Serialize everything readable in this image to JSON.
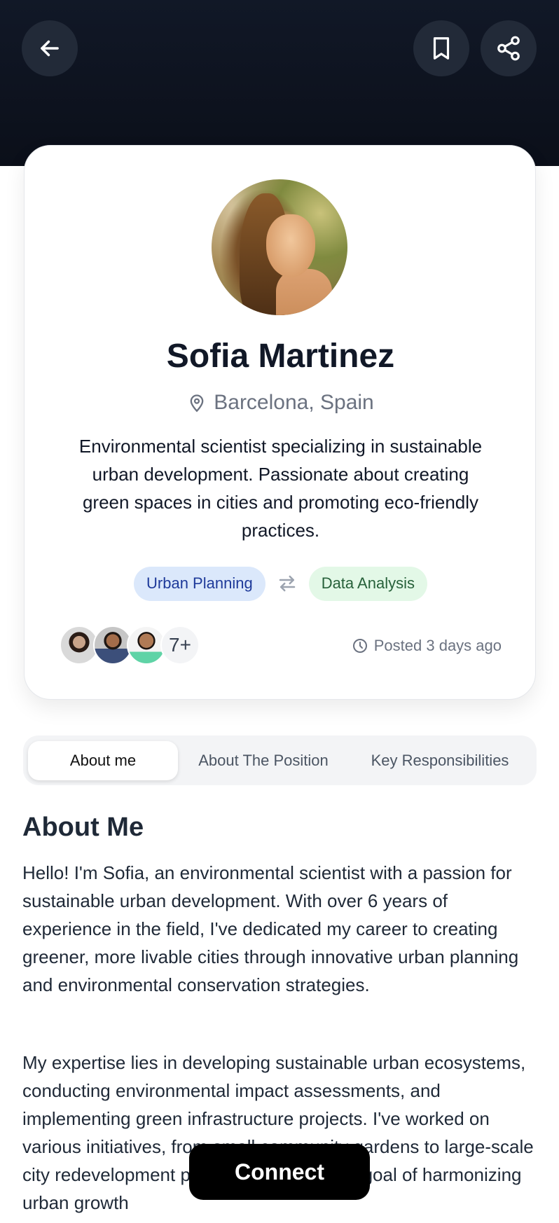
{
  "header": {
    "back_icon": "arrow-left-icon",
    "bookmark_icon": "bookmark-icon",
    "share_icon": "share-icon"
  },
  "profile": {
    "name": "Sofia Martinez",
    "location": "Barcelona, Spain",
    "bio": "Environmental scientist specializing in sustainable urban development. Passionate about creating green spaces in cities and promoting eco-friendly practices.",
    "skills": [
      {
        "label": "Urban Planning",
        "color": "#1e3a9a",
        "bg": "#dbe8fb"
      },
      {
        "label": "Data Analysis",
        "color": "#27613a",
        "bg": "#e3f8e7"
      }
    ],
    "swap_icon": "swap-arrows-icon",
    "team_more": "7+",
    "posted": "Posted 3 days ago"
  },
  "tabs": [
    {
      "label": "About me",
      "active": true
    },
    {
      "label": "About The Position",
      "active": false
    },
    {
      "label": "Key Responsibilities",
      "active": false
    }
  ],
  "about": {
    "title": "About Me",
    "paragraphs": [
      "Hello! I'm Sofia, an environmental scientist with a passion for sustainable urban development. With over 6 years of experience in the field, I've dedicated my career to creating greener, more livable cities through innovative urban planning and environmental conservation strategies.",
      "My expertise lies in developing sustainable urban ecosystems, conducting environmental impact assessments, and implementing green infrastructure projects. I've worked on various initiatives, from small community gardens to large-scale city redevelopment plans, always with the goal of harmonizing urban growth"
    ]
  },
  "actions": {
    "connect_label": "Connect"
  },
  "colors": {
    "header_bg": "#111827",
    "button_bg": "#222a38",
    "primary": "#000000"
  }
}
